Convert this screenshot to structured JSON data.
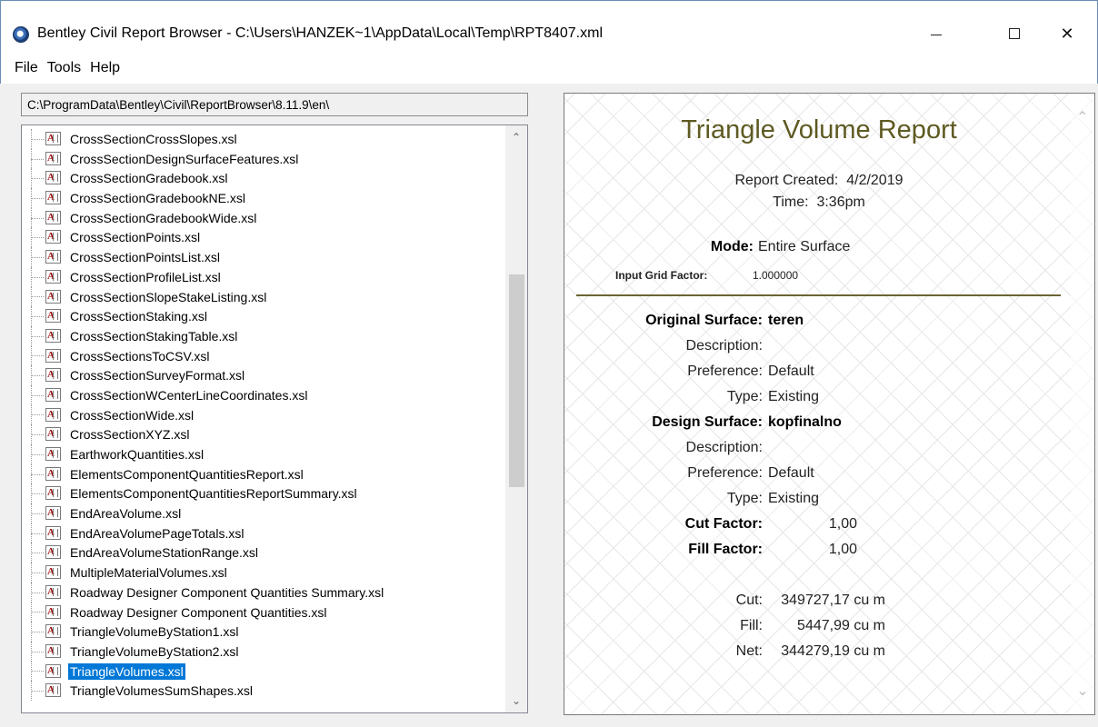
{
  "window": {
    "title": "Bentley Civil Report Browser - C:\\Users\\HANZEK~1\\AppData\\Local\\Temp\\RPT8407.xml"
  },
  "menu": [
    "File",
    "Tools",
    "Help"
  ],
  "path": "C:\\ProgramData\\Bentley\\Civil\\ReportBrowser\\8.11.9\\en\\",
  "files": [
    "CrossSectionCrossSlopes.xsl",
    "CrossSectionDesignSurfaceFeatures.xsl",
    "CrossSectionGradebook.xsl",
    "CrossSectionGradebookNE.xsl",
    "CrossSectionGradebookWide.xsl",
    "CrossSectionPoints.xsl",
    "CrossSectionPointsList.xsl",
    "CrossSectionProfileList.xsl",
    "CrossSectionSlopeStakeListing.xsl",
    "CrossSectionStaking.xsl",
    "CrossSectionStakingTable.xsl",
    "CrossSectionsToCSV.xsl",
    "CrossSectionSurveyFormat.xsl",
    "CrossSectionWCenterLineCoordinates.xsl",
    "CrossSectionWide.xsl",
    "CrossSectionXYZ.xsl",
    "EarthworkQuantities.xsl",
    "ElementsComponentQuantitiesReport.xsl",
    "ElementsComponentQuantitiesReportSummary.xsl",
    "EndAreaVolume.xsl",
    "EndAreaVolumePageTotals.xsl",
    "EndAreaVolumeStationRange.xsl",
    "MultipleMaterialVolumes.xsl",
    "Roadway Designer Component Quantities Summary.xsl",
    "Roadway Designer Component Quantities.xsl",
    "TriangleVolumeByStation1.xsl",
    "TriangleVolumeByStation2.xsl",
    "TriangleVolumes.xsl",
    "TriangleVolumesSumShapes.xsl"
  ],
  "selected_file": "TriangleVolumes.xsl",
  "report": {
    "title": "Triangle Volume Report",
    "created_label": "Report Created:",
    "created_value": "4/2/2019",
    "time_label": "Time:",
    "time_value": "3:36pm",
    "mode_label": "Mode:",
    "mode_value": "Entire Surface",
    "grid_label": "Input Grid Factor:",
    "grid_value": "1.000000",
    "original_label": "Original Surface:",
    "original_value": "teren",
    "design_label": "Design Surface:",
    "design_value": "kopfinalno",
    "description_label": "Description:",
    "preference_label": "Preference:",
    "preference_value": "Default",
    "type_label": "Type:",
    "type_value": "Existing",
    "cut_factor_label": "Cut Factor:",
    "cut_factor_value": "1,00",
    "fill_factor_label": "Fill Factor:",
    "fill_factor_value": "1,00",
    "cut_label": "Cut:",
    "cut_value": "349727,17 cu m",
    "fill_label": "Fill:",
    "fill_value": "5447,99 cu m",
    "net_label": "Net:",
    "net_value": "344279,19 cu m"
  },
  "icons": {
    "app": "bentley-app-icon",
    "file": "xsl-file-icon"
  }
}
